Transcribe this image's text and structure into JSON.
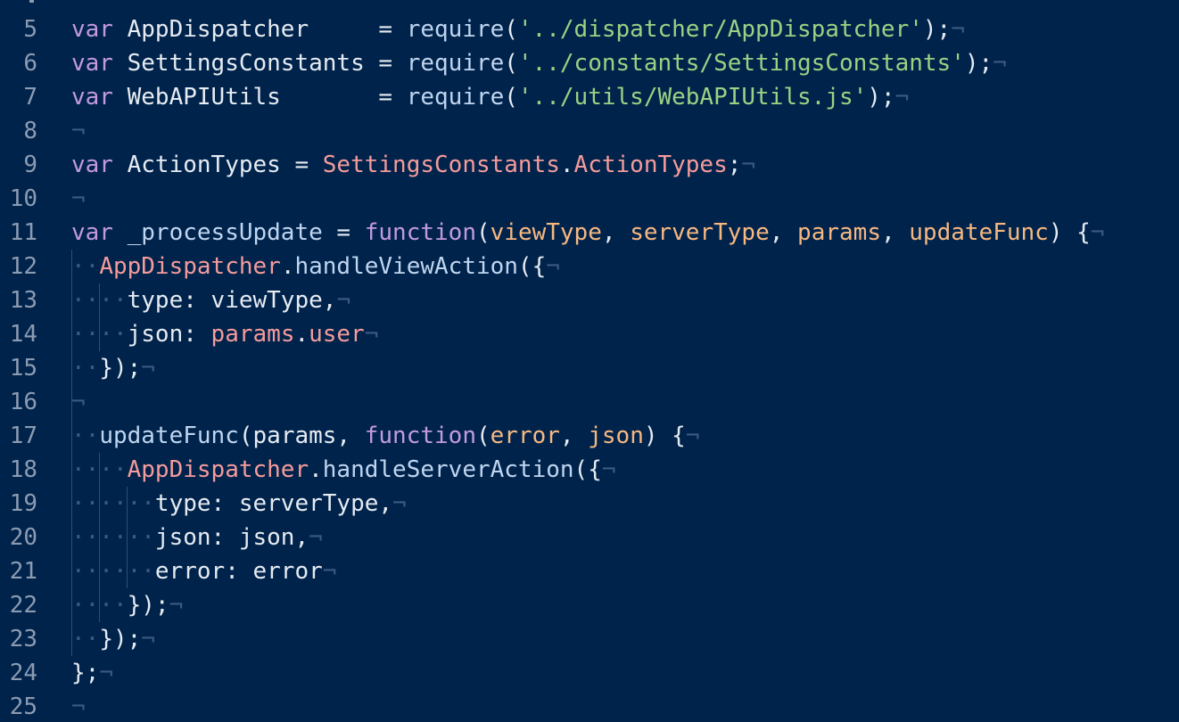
{
  "editor": {
    "theme_colors": {
      "background": "#00234b",
      "keyword": "#c39ae0",
      "string": "#9bd184",
      "class": "#f59b9b",
      "parameter": "#f7b880",
      "text": "#e6ebf2",
      "line_number": "#8b9bb2",
      "invisibles": "#3c5a80"
    },
    "invisible_eol": "¬",
    "invisible_space": "·",
    "lines": [
      {
        "num": "5",
        "tokens": [
          [
            "kw",
            "var"
          ],
          [
            "plain",
            " AppDispatcher     = "
          ],
          [
            "fn",
            "require"
          ],
          [
            "plain",
            "("
          ],
          [
            "str",
            "'../dispatcher/AppDispatcher'"
          ],
          [
            "plain",
            ");"
          ],
          [
            "eol",
            "¬"
          ]
        ]
      },
      {
        "num": "6",
        "tokens": [
          [
            "kw",
            "var"
          ],
          [
            "plain",
            " SettingsConstants = "
          ],
          [
            "fn",
            "require"
          ],
          [
            "plain",
            "("
          ],
          [
            "str",
            "'../constants/SettingsConstants'"
          ],
          [
            "plain",
            ");"
          ],
          [
            "eol",
            "¬"
          ]
        ]
      },
      {
        "num": "7",
        "tokens": [
          [
            "kw",
            "var"
          ],
          [
            "plain",
            " WebAPIUtils       = "
          ],
          [
            "fn",
            "require"
          ],
          [
            "plain",
            "("
          ],
          [
            "str",
            "'../utils/WebAPIUtils.js'"
          ],
          [
            "plain",
            ");"
          ],
          [
            "eol",
            "¬"
          ]
        ]
      },
      {
        "num": "8",
        "tokens": [
          [
            "eol",
            "¬"
          ]
        ]
      },
      {
        "num": "9",
        "tokens": [
          [
            "kw",
            "var"
          ],
          [
            "plain",
            " ActionTypes = "
          ],
          [
            "cls",
            "SettingsConstants"
          ],
          [
            "plain",
            "."
          ],
          [
            "cls",
            "ActionTypes"
          ],
          [
            "plain",
            ";"
          ],
          [
            "eol",
            "¬"
          ]
        ]
      },
      {
        "num": "10",
        "tokens": [
          [
            "eol",
            "¬"
          ]
        ]
      },
      {
        "num": "11",
        "tokens": [
          [
            "kw",
            "var"
          ],
          [
            "fn",
            " _processUpdate"
          ],
          [
            "plain",
            " = "
          ],
          [
            "kw",
            "function"
          ],
          [
            "plain",
            "("
          ],
          [
            "par",
            "viewType"
          ],
          [
            "plain",
            ", "
          ],
          [
            "par",
            "serverType"
          ],
          [
            "plain",
            ", "
          ],
          [
            "par",
            "params"
          ],
          [
            "plain",
            ", "
          ],
          [
            "par",
            "updateFunc"
          ],
          [
            "plain",
            ") {"
          ],
          [
            "eol",
            "¬"
          ]
        ]
      },
      {
        "num": "12",
        "tokens": [
          [
            "ws",
            "··"
          ],
          [
            "cls",
            "AppDispatcher"
          ],
          [
            "plain",
            "."
          ],
          [
            "fn",
            "handleViewAction"
          ],
          [
            "plain",
            "({"
          ],
          [
            "eol",
            "¬"
          ]
        ]
      },
      {
        "num": "13",
        "tokens": [
          [
            "ws",
            "····"
          ],
          [
            "plain",
            "type: viewType,"
          ],
          [
            "eol",
            "¬"
          ]
        ]
      },
      {
        "num": "14",
        "tokens": [
          [
            "ws",
            "····"
          ],
          [
            "plain",
            "json: "
          ],
          [
            "cls",
            "params"
          ],
          [
            "plain",
            "."
          ],
          [
            "cls",
            "user"
          ],
          [
            "eol",
            "¬"
          ]
        ]
      },
      {
        "num": "15",
        "tokens": [
          [
            "ws",
            "··"
          ],
          [
            "plain",
            "});"
          ],
          [
            "eol",
            "¬"
          ]
        ]
      },
      {
        "num": "16",
        "tokens": [
          [
            "eol",
            "¬"
          ]
        ]
      },
      {
        "num": "17",
        "tokens": [
          [
            "ws",
            "··"
          ],
          [
            "fn",
            "updateFunc"
          ],
          [
            "plain",
            "(params, "
          ],
          [
            "kw",
            "function"
          ],
          [
            "plain",
            "("
          ],
          [
            "par",
            "error"
          ],
          [
            "plain",
            ", "
          ],
          [
            "par",
            "json"
          ],
          [
            "plain",
            ") {"
          ],
          [
            "eol",
            "¬"
          ]
        ]
      },
      {
        "num": "18",
        "tokens": [
          [
            "ws",
            "····"
          ],
          [
            "cls",
            "AppDispatcher"
          ],
          [
            "plain",
            "."
          ],
          [
            "fn",
            "handleServerAction"
          ],
          [
            "plain",
            "({"
          ],
          [
            "eol",
            "¬"
          ]
        ]
      },
      {
        "num": "19",
        "tokens": [
          [
            "ws",
            "······"
          ],
          [
            "plain",
            "type: serverType,"
          ],
          [
            "eol",
            "¬"
          ]
        ]
      },
      {
        "num": "20",
        "tokens": [
          [
            "ws",
            "······"
          ],
          [
            "plain",
            "json: json,"
          ],
          [
            "eol",
            "¬"
          ]
        ]
      },
      {
        "num": "21",
        "tokens": [
          [
            "ws",
            "······"
          ],
          [
            "plain",
            "error: error"
          ],
          [
            "eol",
            "¬"
          ]
        ]
      },
      {
        "num": "22",
        "tokens": [
          [
            "ws",
            "····"
          ],
          [
            "plain",
            "});"
          ],
          [
            "eol",
            "¬"
          ]
        ]
      },
      {
        "num": "23",
        "tokens": [
          [
            "ws",
            "··"
          ],
          [
            "plain",
            "});"
          ],
          [
            "eol",
            "¬"
          ]
        ]
      },
      {
        "num": "24",
        "tokens": [
          [
            "plain",
            "};"
          ],
          [
            "eol",
            "¬"
          ]
        ]
      },
      {
        "num": "25",
        "tokens": [
          [
            "eol",
            "¬"
          ]
        ]
      }
    ]
  }
}
